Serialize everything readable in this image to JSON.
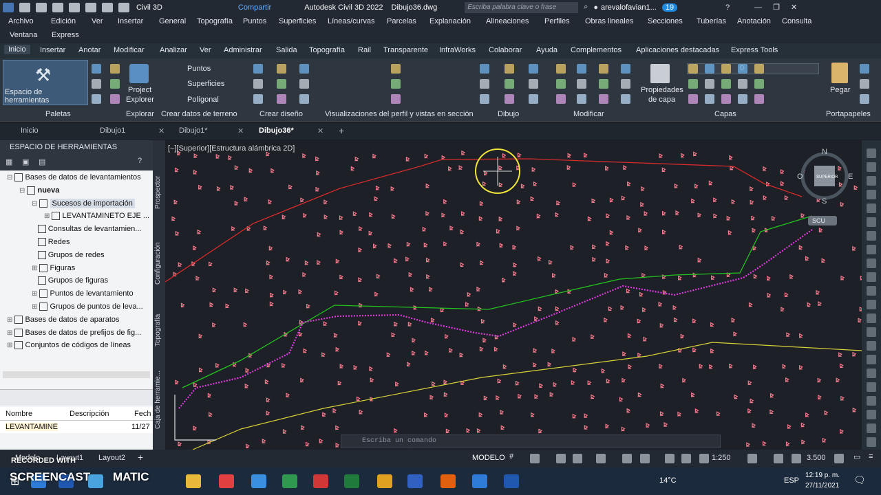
{
  "titlebar": {
    "workspace": "Civil 3D",
    "share": "Compartir",
    "app": "Autodesk Civil 3D 2022",
    "file": "Dibujo36.dwg",
    "search_placeholder": "Escriba palabra clave o frase",
    "user": "arevalofavian1...",
    "badge": "19"
  },
  "menu": {
    "row1": [
      "Archivo",
      "Edición",
      "Ver",
      "Insertar",
      "General",
      "Topografía",
      "Puntos",
      "Superficies",
      "Líneas/curvas",
      "Parcelas",
      "Explanación",
      "Alineaciones",
      "Perfiles",
      "Obras lineales",
      "Secciones",
      "Tuberías",
      "Anotación",
      "Consulta"
    ],
    "row2": [
      "Ventana",
      "Express"
    ]
  },
  "ribbon_tabs": [
    "Inicio",
    "Insertar",
    "Anotar",
    "Modificar",
    "Analizar",
    "Ver",
    "Administrar",
    "Salida",
    "Topografía",
    "Rail",
    "Transparente",
    "InfraWorks",
    "Colaborar",
    "Ayuda",
    "Complementos",
    "Aplicaciones destacadas",
    "Express Tools"
  ],
  "ribbon": {
    "tool_space": "Espacio de herramientas",
    "project": "Project",
    "explorer": "Explorer",
    "puntos": "Puntos",
    "superficies": "Superficies",
    "polygonal": "Polígonal",
    "prop": "Propiedades",
    "de_capa": "de capa",
    "layer": "0",
    "pegar": "Pegar",
    "panels": [
      "Paletas",
      "Explorar",
      "Crear datos de terreno",
      "Crear diseño",
      "Visualizaciones del perfil y vistas en sección",
      "Dibujo",
      "Modificar",
      "Capas",
      "Portapapeles"
    ]
  },
  "doc_tabs": [
    "Inicio",
    "Dibujo1",
    "Dibujo1*",
    "Dibujo36*"
  ],
  "palette": {
    "title": "ESPACIO DE HERRAMIENTAS",
    "tree": [
      "Bases de datos de levantamientos",
      "nueva",
      "Sucesos de importación",
      "LEVANTAMINETO EJE ...",
      "Consultas de levantamien...",
      "Redes",
      "Grupos de redes",
      "Figuras",
      "Grupos de figuras",
      "Puntos de levantamiento",
      "Grupos de puntos de leva...",
      "Bases de datos de aparatos",
      "Bases de datos de prefijos de fig...",
      "Conjuntos de códigos de líneas"
    ],
    "cols": [
      "Nombre",
      "Descripción",
      "Fech"
    ],
    "row": [
      "LEVANTAMINE",
      "",
      "11/27"
    ]
  },
  "vtabs": [
    "Prospector",
    "Configuración",
    "Topografía",
    "Caja de herramie..."
  ],
  "canvas": {
    "view_label": "[−][Superior][Estructura alámbrica 2D]",
    "compass": {
      "n": "N",
      "s": "S",
      "e": "E",
      "o": "O",
      "cube": "SUPERIOR",
      "scu": "SCU"
    },
    "command_placeholder": "Escriba un comando"
  },
  "status": {
    "layouts": [
      "Modelo",
      "Layout1",
      "Layout2"
    ],
    "modelo": "MODELO",
    "scale": "1:250",
    "value": "3.500"
  },
  "taskbar": {
    "weather": "14°C",
    "lang": "ESP",
    "time": "12:19 p. m.",
    "date": "27/11/2021"
  },
  "watermark": {
    "line1": "RECORDED WITH",
    "line2": "SCREENCAST",
    "line3": "MATIC"
  },
  "colors": {
    "red": "#d52b2b",
    "green": "#23c31f",
    "magenta": "#e03be0",
    "yellow": "#d8d23a",
    "point": "#f27a8c"
  }
}
